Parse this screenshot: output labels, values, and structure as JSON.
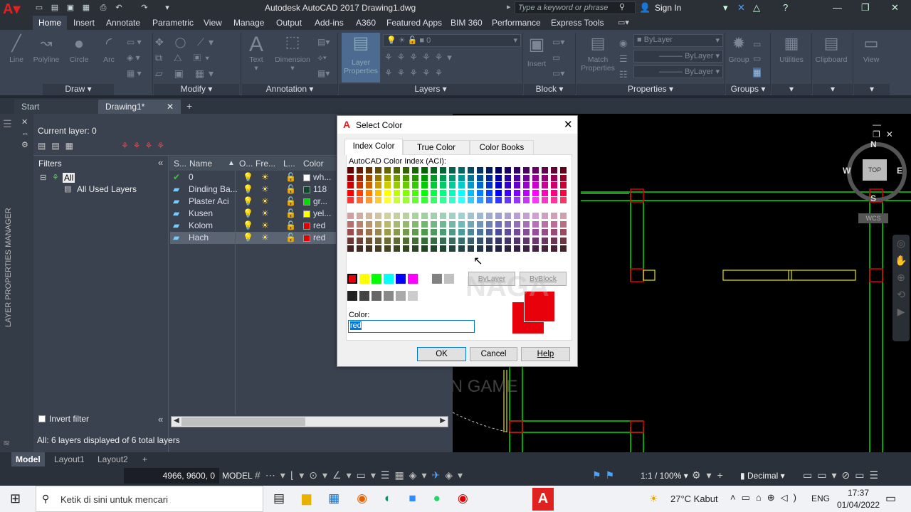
{
  "app": {
    "title": "Autodesk AutoCAD 2017    Drawing1.dwg",
    "search_placeholder": "Type a keyword or phrase",
    "sign_in": "Sign In"
  },
  "ribbon_tabs": [
    "Home",
    "Insert",
    "Annotate",
    "Parametric",
    "View",
    "Manage",
    "Output",
    "Add-ins",
    "A360",
    "Featured Apps",
    "BIM 360",
    "Performance",
    "Express Tools"
  ],
  "ribbon": {
    "draw": [
      "Line",
      "Polyline",
      "Circle",
      "Arc"
    ],
    "annotation": [
      "Text",
      "Dimension"
    ],
    "layer_props": "Layer Properties",
    "layer_current": "0",
    "block_btn": "Insert",
    "match": "Match Properties",
    "bylayer1": "ByLayer",
    "bylayer2": "ByLayer",
    "bylayer3": "ByLayer",
    "group": "Group",
    "utilities": "Utilities",
    "clipboard": "Clipboard",
    "view": "View",
    "panels": [
      "Draw ▾",
      "Modify ▾",
      "Annotation ▾",
      "Layers ▾",
      "Block ▾",
      "Properties ▾",
      "Groups ▾"
    ]
  },
  "doc_tabs": {
    "start": "Start",
    "drawing": "Drawing1*",
    "add": "+"
  },
  "layer_manager": {
    "current_layer": "Current layer: 0",
    "filters_label": "Filters",
    "filter_all": "All",
    "filter_used": "All Used Layers",
    "invert_filter": "Invert filter",
    "status_text": "All: 6 layers displayed of 6 total layers",
    "side_label": "LAYER PROPERTIES MANAGER",
    "columns": [
      "S...",
      "Name",
      "O...",
      "Fre...",
      "L...",
      "Color"
    ],
    "layers": [
      {
        "name": "0",
        "color_label": "wh...",
        "color": "#ffffff"
      },
      {
        "name": "Dinding Ba...",
        "color_label": "118",
        "color": "#0a4a2a"
      },
      {
        "name": "Plaster Aci",
        "color_label": "gr...",
        "color": "#00dd00"
      },
      {
        "name": "Kusen",
        "color_label": "yel...",
        "color": "#ffff00"
      },
      {
        "name": "Kolom",
        "color_label": "red",
        "color": "#e00000"
      },
      {
        "name": "Hach",
        "color_label": "red",
        "color": "#e00000"
      }
    ]
  },
  "dialog": {
    "title": "Select Color",
    "tabs": [
      "Index Color",
      "True Color",
      "Color Books"
    ],
    "aci_label": "AutoCAD Color Index (ACI):",
    "bylayer": "ByLayer",
    "byblock": "ByBlock",
    "color_label": "Color:",
    "color_value": "red",
    "ok": "OK",
    "cancel": "Cancel",
    "help": "Help",
    "selected_color": "#e8000b"
  },
  "viewcube": {
    "n": "N",
    "s": "S",
    "e": "E",
    "w": "W",
    "top": "TOP",
    "wcs": "WCS"
  },
  "layout_tabs": [
    "Model",
    "Layout1",
    "Layout2",
    "+"
  ],
  "statusbar": {
    "coords": "4966, 9600, 0",
    "model": "MODEL",
    "scale": "1:1 / 100%",
    "units": "Decimal"
  },
  "watermark": {
    "line1": "NAGA",
    "line2": "VLOG DAN GAME"
  },
  "taskbar": {
    "search": "Ketik di sini untuk mencari",
    "weather": "27°C  Kabut",
    "lang": "ENG",
    "time": "17:37",
    "date": "01/04/2022"
  }
}
